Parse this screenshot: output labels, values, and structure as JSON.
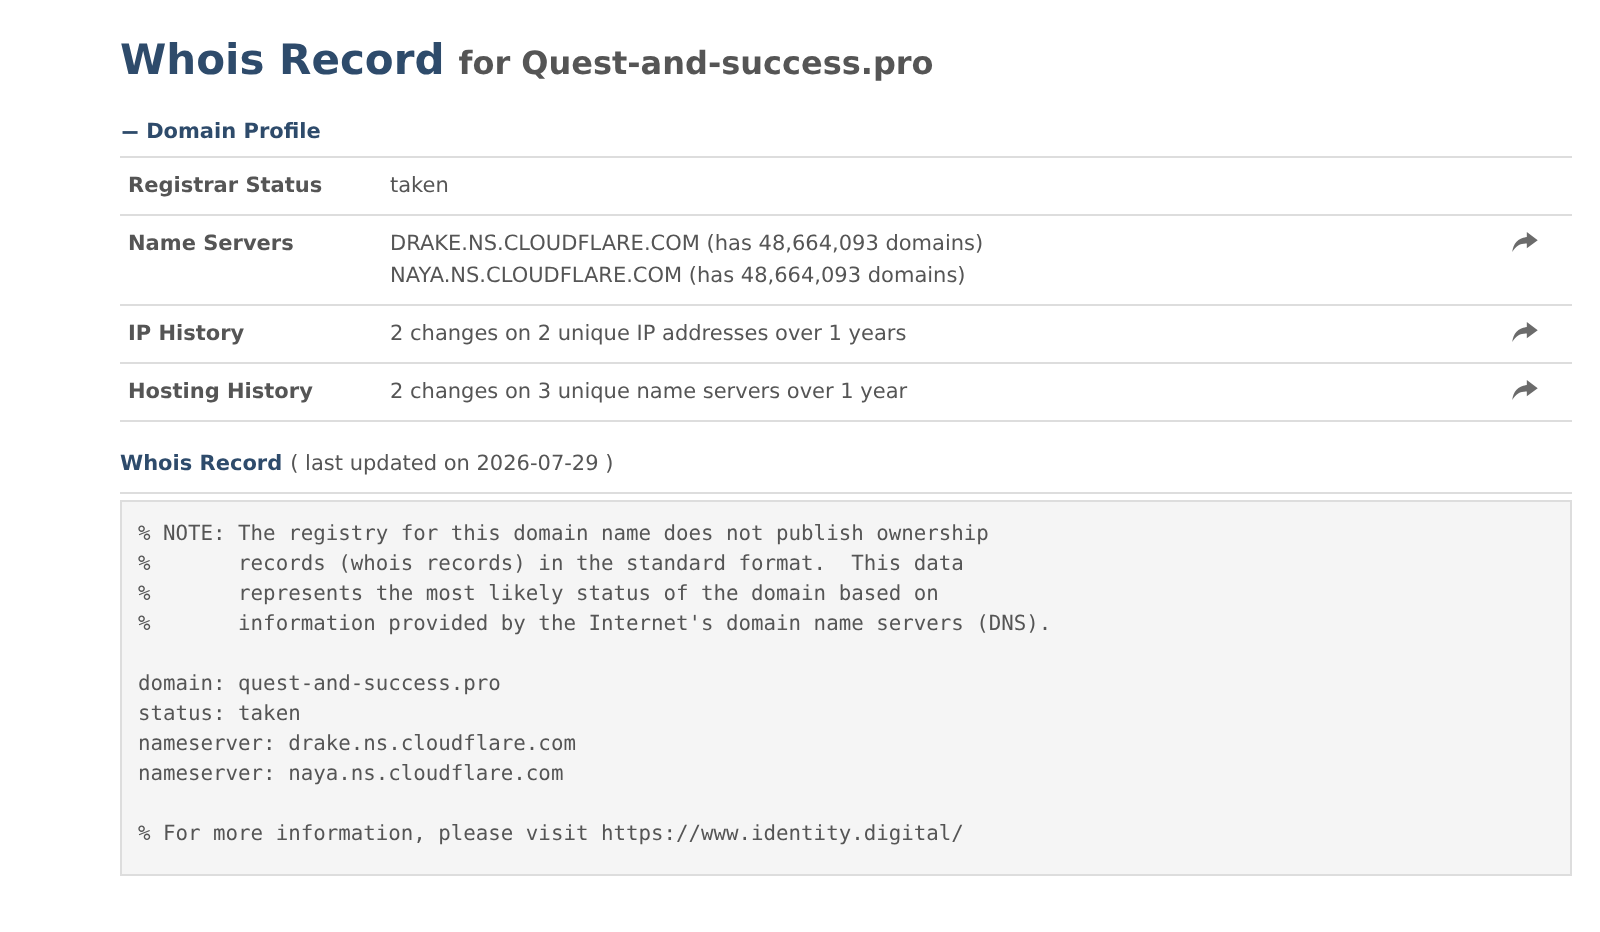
{
  "heading": {
    "title": "Whois Record",
    "subtitle": "for Quest-and-success.pro"
  },
  "profile": {
    "toggle": "−",
    "label": "Domain Profile",
    "rows": [
      {
        "label": "Registrar Status",
        "values": [
          "taken"
        ],
        "has_link": false
      },
      {
        "label": "Name Servers",
        "values": [
          "DRAKE.NS.CLOUDFLARE.COM (has 48,664,093 domains)",
          "NAYA.NS.CLOUDFLARE.COM (has 48,664,093 domains)"
        ],
        "has_link": true
      },
      {
        "label": "IP History",
        "values": [
          "2 changes on 2 unique IP addresses over 1 years"
        ],
        "has_link": true
      },
      {
        "label": "Hosting History",
        "values": [
          "2 changes on 3 unique name servers over 1 year"
        ],
        "has_link": true
      }
    ]
  },
  "record": {
    "label": "Whois Record",
    "updated": "( last updated on 2026-07-29 )",
    "paragraphs": [
      [
        "% NOTE: The registry for this domain name does not publish ownership",
        "%       records (whois records) in the standard format.  This data",
        "%       represents the most likely status of the domain based on",
        "%       information provided by the Internet's domain name servers (DNS)."
      ],
      [
        "domain: quest-and-success.pro",
        "status: taken",
        "nameserver: drake.ns.cloudflare.com",
        "nameserver: naya.ns.cloudflare.com"
      ],
      [
        "% For more information, please visit https://www.identity.digital/"
      ]
    ]
  }
}
